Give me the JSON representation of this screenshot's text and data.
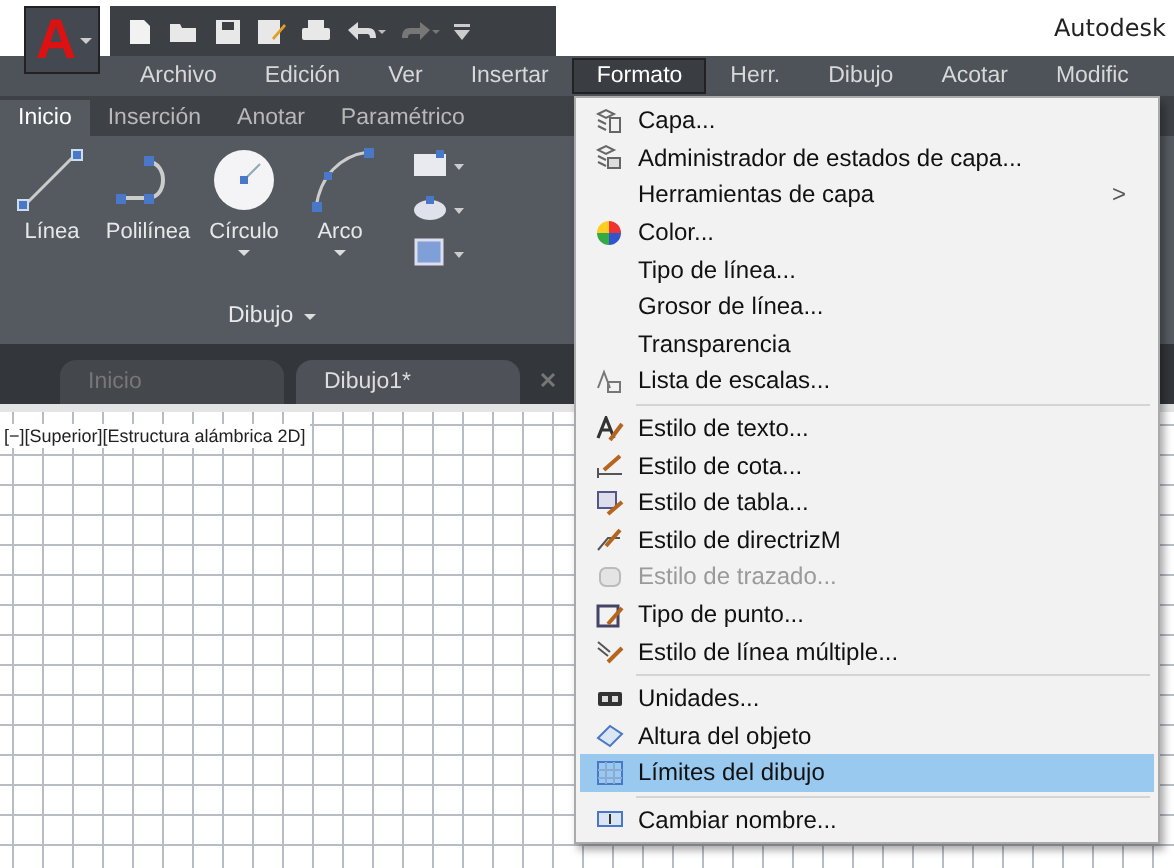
{
  "app_menu": {
    "label": "A"
  },
  "title": "Autodesk",
  "menu_bar": [
    {
      "label": "Archivo",
      "selected": false
    },
    {
      "label": "Edición",
      "selected": false
    },
    {
      "label": "Ver",
      "selected": false
    },
    {
      "label": "Insertar",
      "selected": false
    },
    {
      "label": "Formato",
      "selected": true
    },
    {
      "label": "Herr.",
      "selected": false
    },
    {
      "label": "Dibujo",
      "selected": false
    },
    {
      "label": "Acotar",
      "selected": false
    },
    {
      "label": "Modific",
      "selected": false
    }
  ],
  "ribbon_tabs": [
    {
      "label": "Inicio",
      "selected": true
    },
    {
      "label": "Inserción",
      "selected": false
    },
    {
      "label": "Anotar",
      "selected": false
    },
    {
      "label": "Paramétrico",
      "selected": false
    }
  ],
  "ribbon_tools": [
    {
      "label": "Línea",
      "kind": "line",
      "dropdown": false
    },
    {
      "label": "Polilínea",
      "kind": "polyline",
      "dropdown": false
    },
    {
      "label": "Círculo",
      "kind": "circle",
      "dropdown": true
    },
    {
      "label": "Arco",
      "kind": "arc",
      "dropdown": true
    }
  ],
  "panel_label": "Dibujo",
  "file_tabs": [
    {
      "label": "Inicio",
      "selected": false
    },
    {
      "label": "Dibujo1*",
      "selected": true
    }
  ],
  "viewport_label": "[−][Superior][Estructura alámbrica 2D]",
  "dropdown_menu": {
    "groups": [
      {
        "items": [
          {
            "label": "Capa...",
            "kind": "layer",
            "disabled": false,
            "selected": false
          },
          {
            "label": "Administrador de estados de capa...",
            "kind": "layerstate",
            "disabled": false,
            "selected": false
          },
          {
            "label": "Herramientas de capa",
            "submenu_arrow": ">",
            "disabled": false,
            "selected": false
          },
          {
            "label": "Color...",
            "kind": "color",
            "disabled": false,
            "selected": false
          },
          {
            "label": "Tipo de línea...",
            "disabled": false,
            "selected": false
          },
          {
            "label": "Grosor de línea...",
            "disabled": false,
            "selected": false
          },
          {
            "label": "Transparencia",
            "disabled": false,
            "selected": false
          },
          {
            "label": "Lista de escalas...",
            "kind": "scale",
            "disabled": false,
            "selected": false
          }
        ]
      },
      {
        "items": [
          {
            "label": "Estilo de texto...",
            "kind": "textstyle",
            "disabled": false,
            "selected": false
          },
          {
            "label": "Estilo de cota...",
            "kind": "dimstyle",
            "disabled": false,
            "selected": false
          },
          {
            "label": "Estilo de tabla...",
            "kind": "tablestyle",
            "disabled": false,
            "selected": false
          },
          {
            "label": "Estilo de directrizM",
            "kind": "leader",
            "disabled": false,
            "selected": false
          },
          {
            "label": "Estilo de trazado...",
            "kind": "plot",
            "disabled": true,
            "selected": false
          },
          {
            "label": "Tipo de punto...",
            "kind": "point",
            "disabled": false,
            "selected": false
          },
          {
            "label": "Estilo de línea múltiple...",
            "kind": "mline",
            "disabled": false,
            "selected": false
          }
        ]
      },
      {
        "items": [
          {
            "label": "Unidades...",
            "kind": "units",
            "disabled": false,
            "selected": false
          },
          {
            "label": "Altura del objeto",
            "kind": "thickness",
            "disabled": false,
            "selected": false
          },
          {
            "label": "Límites del dibujo",
            "kind": "limits",
            "disabled": false,
            "selected": true
          }
        ]
      },
      {
        "items": [
          {
            "label": "Cambiar nombre...",
            "kind": "rename",
            "disabled": false,
            "selected": false
          }
        ]
      }
    ]
  }
}
